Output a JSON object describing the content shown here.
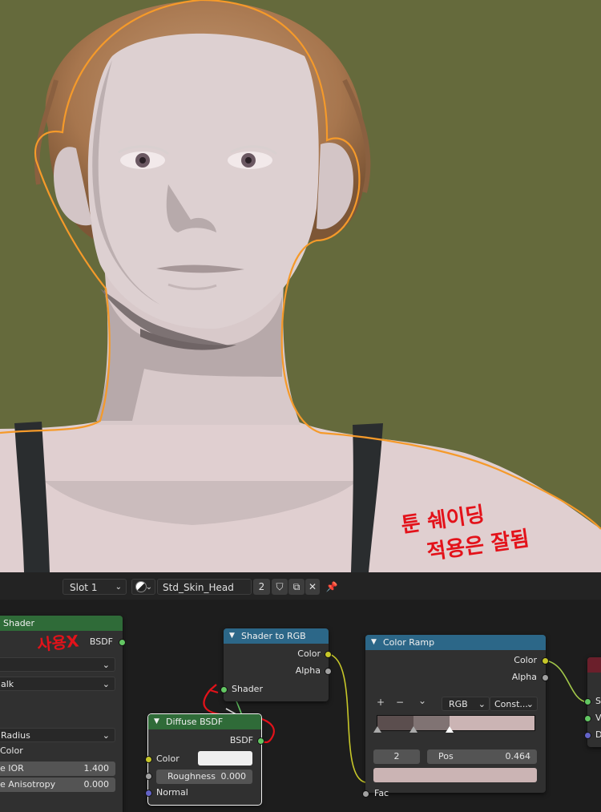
{
  "viewport": {
    "annotation_line1": "툰 쉐이딩",
    "annotation_line2": "적용은 잘됨",
    "annotation_color": "#e3121a",
    "outline_color": "#f59a2a",
    "background_color": "#656a3c"
  },
  "header": {
    "slot": "Slot 1",
    "material_name": "Std_Skin_Head",
    "user_count": "2"
  },
  "nodes": {
    "sss_shader": {
      "title": "Shader",
      "header_color": "#2f6b38",
      "output_label": "BSDF",
      "annotation": "사용X",
      "field_radius": "Radius",
      "field_walk": "alk",
      "label_color": "Color",
      "ior_label": "e IOR",
      "ior_value": "1.400",
      "aniso_label": "e Anisotropy",
      "aniso_value": "0.000"
    },
    "shader_to_rgb": {
      "title": "Shader to RGB",
      "header_color": "#2c6788",
      "out_color": "Color",
      "out_alpha": "Alpha",
      "in_shader": "Shader"
    },
    "diffuse": {
      "title": "Diffuse BSDF",
      "header_color": "#2f6b38",
      "out_bsdf": "BSDF",
      "in_color": "Color",
      "color_swatch": "#efefef",
      "roughness_label": "Roughness",
      "roughness_value": "0.000",
      "in_normal": "Normal"
    },
    "color_ramp": {
      "title": "Color Ramp",
      "header_color": "#2c6788",
      "out_color": "Color",
      "out_alpha": "Alpha",
      "add": "+",
      "remove": "−",
      "more": "⌄",
      "color_mode": "RGB",
      "interpolation": "Const...",
      "stop_index": "2",
      "pos_label": "Pos",
      "pos_value": "0.464",
      "stop_color": "#cbb4b4",
      "in_fac": "Fac"
    },
    "output_node": {
      "header_color": "#6b1f2b",
      "in_s": "S",
      "in_v": "V",
      "in_d": "D"
    }
  }
}
